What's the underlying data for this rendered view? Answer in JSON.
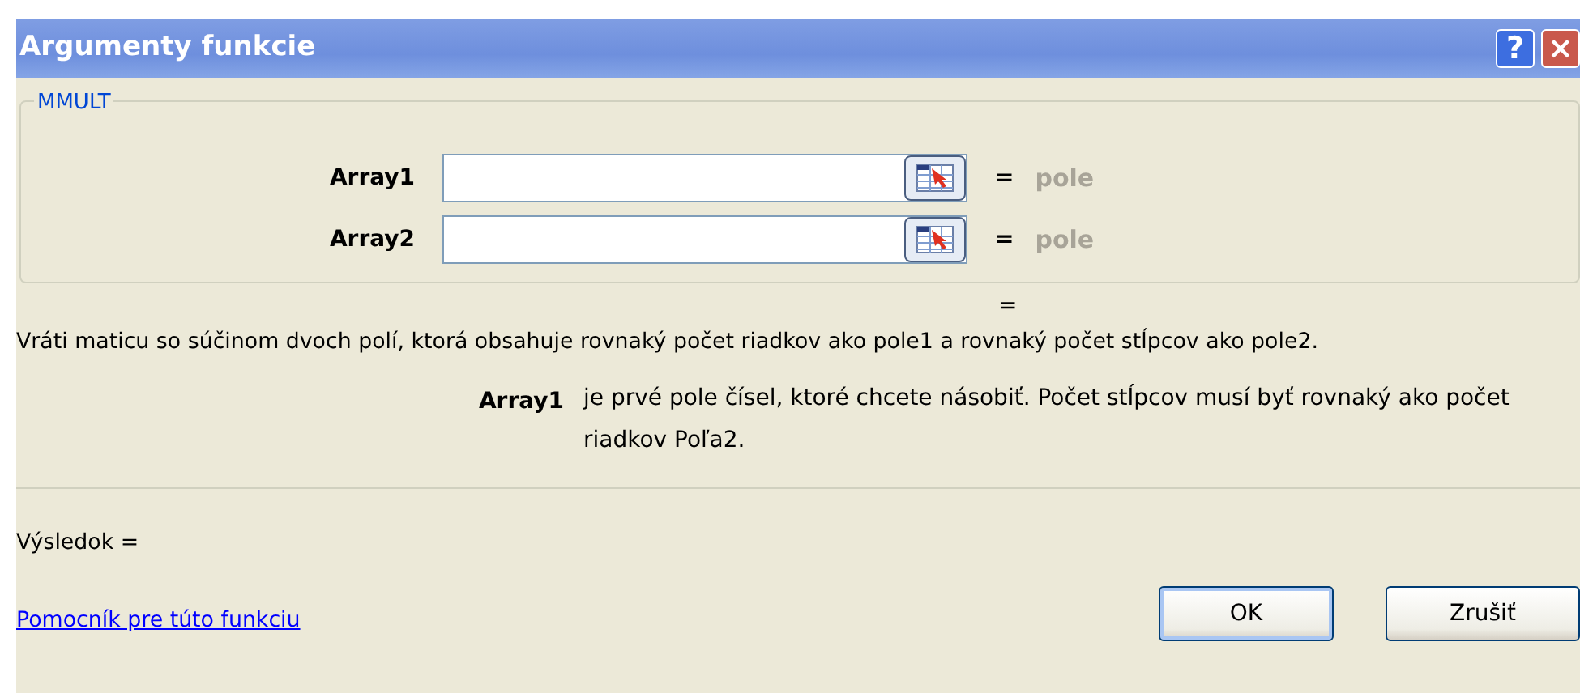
{
  "window": {
    "title": "Argumenty funkcie",
    "help_button": "?",
    "close_button": "×"
  },
  "function_group": {
    "legend": "MMULT",
    "arguments": [
      {
        "label": "Array1",
        "equals": "=",
        "result": "pole"
      },
      {
        "label": "Array2",
        "equals": "=",
        "result": "pole"
      }
    ]
  },
  "formula_result": "=",
  "description": "Vráti maticu so súčinom dvoch polí, ktorá obsahuje rovnaký počet riadkov ako pole1 a rovnaký počet stĺpcov ako pole2.",
  "argument_help": {
    "name": "Array1",
    "text": "je prvé pole čísel, ktoré chcete násobiť. Počet stĺpcov musí byť rovnaký ako počet riadkov Poľa2."
  },
  "result_line": "Výsledok =",
  "help_link": "Pomocník pre túto funkciu",
  "buttons": [
    {
      "label": "OK",
      "default": true
    },
    {
      "label": "Zrušiť",
      "default": false
    }
  ]
}
